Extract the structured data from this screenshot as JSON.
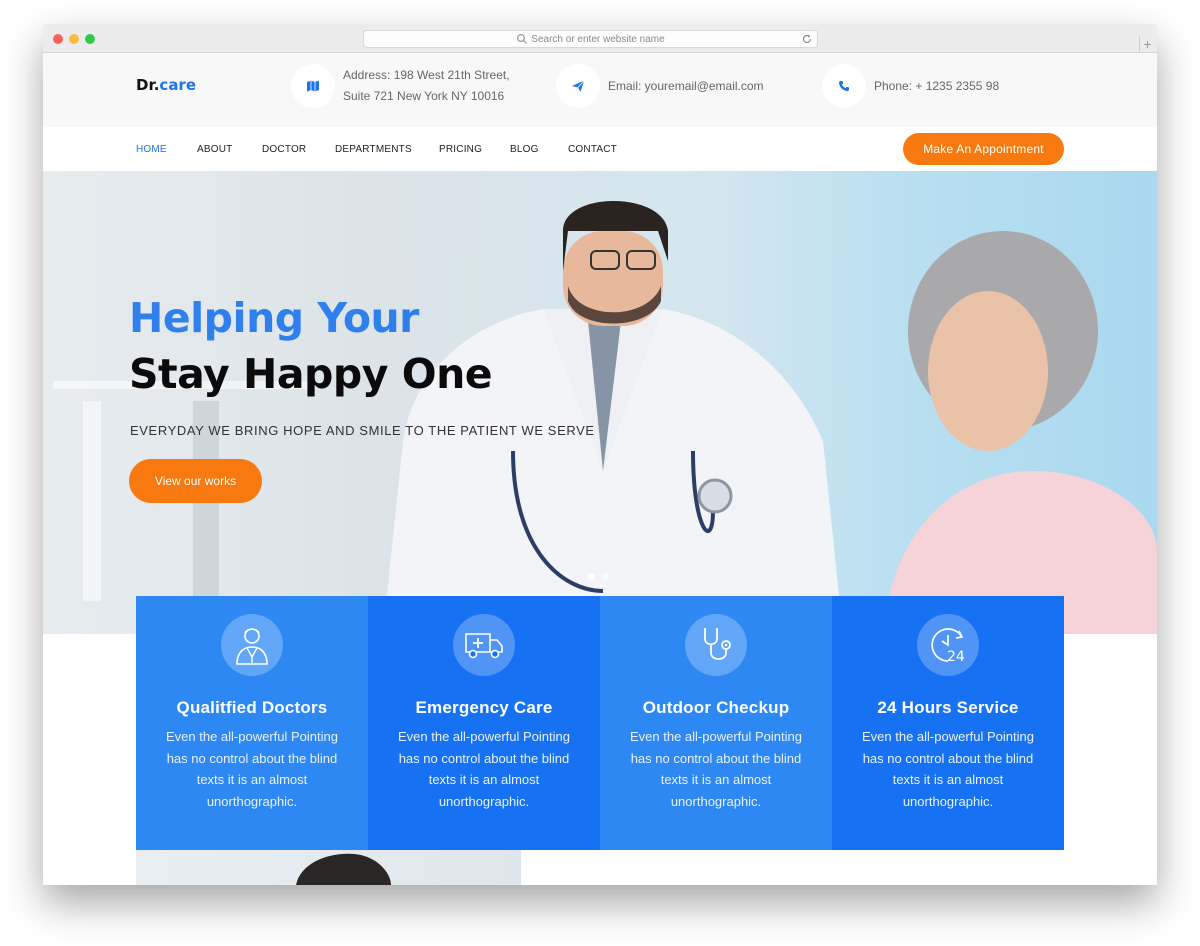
{
  "browser": {
    "url_placeholder": "Search or enter website name",
    "new_tab": "+"
  },
  "brand": {
    "prefix": "Dr.",
    "accent": "care"
  },
  "contact": {
    "address_line1": "Address: 198 West 21th Street,",
    "address_line2": "Suite 721 New York NY 10016",
    "email": "Email: youremail@email.com",
    "phone": "Phone: + 1235 2355 98"
  },
  "nav": {
    "items": [
      "HOME",
      "ABOUT",
      "DOCTOR",
      "DEPARTMENTS",
      "PRICING",
      "BLOG",
      "CONTACT"
    ],
    "active": "HOME",
    "cta": "Make An Appointment"
  },
  "hero": {
    "title_line1": "Helping Your",
    "title_line2": "Stay Happy One",
    "subtitle": "EVERYDAY WE BRING HOPE AND SMILE TO THE PATIENT WE SERVE",
    "button": "View our works"
  },
  "features": [
    {
      "icon": "doctor-icon",
      "title": "Qualitfied Doctors",
      "desc": "Even the all-powerful Pointing has no control about the blind texts it is an almost unorthographic.",
      "color": "#2e88f4"
    },
    {
      "icon": "ambulance-icon",
      "title": "Emergency Care",
      "desc": "Even the all-powerful Pointing has no control about the blind texts it is an almost unorthographic.",
      "color": "#1672f2"
    },
    {
      "icon": "stethoscope-icon",
      "title": "Outdoor Checkup",
      "desc": "Even the all-powerful Pointing has no control about the blind texts it is an almost unorthographic.",
      "color": "#2e88f4"
    },
    {
      "icon": "24-hours-icon",
      "title": "24 Hours Service",
      "desc": "Even the all-powerful Pointing has no control about the blind texts it is an almost unorthographic.",
      "color": "#1672f2"
    }
  ],
  "colors": {
    "brand_blue": "#1e74e8",
    "accent_orange": "#f7790f",
    "feature_light": "#2e88f4",
    "feature_dark": "#1672f2"
  }
}
